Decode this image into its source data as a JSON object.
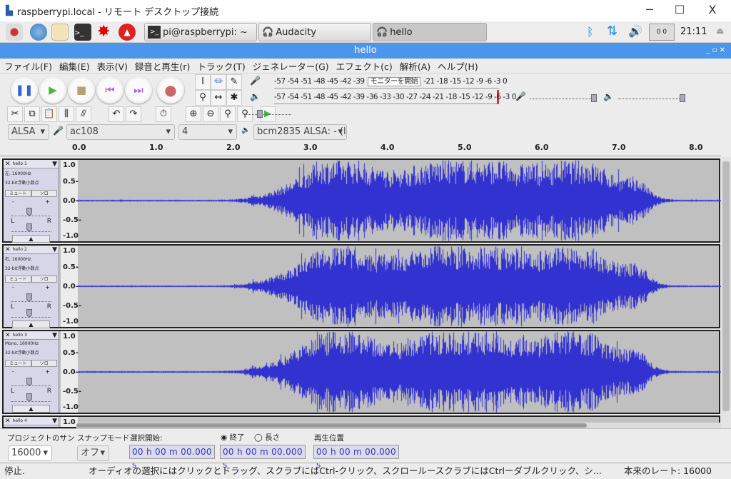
{
  "window": {
    "title": "raspberrypi.local - リモート デスクトップ接続",
    "min": "─",
    "max": "☐",
    "close": "X"
  },
  "taskbar": {
    "tasks": [
      {
        "label": "pi@raspberrypi: ~"
      },
      {
        "label": "Audacity"
      },
      {
        "label": "hello"
      }
    ],
    "clock": "21:11",
    "cpu": "0 0"
  },
  "app": {
    "title": "hello"
  },
  "menu": [
    "ファイル(F)",
    "編集(E)",
    "表示(V)",
    "録音と再生(r)",
    "トラック(T)",
    "ジェネレーター(G)",
    "エフェクト(c)",
    "解析(A)",
    "ヘルプ(H)"
  ],
  "meters": {
    "rec_scale": "-57 -54 -51 -48 -45 -42 -39",
    "rec_scale2": "-21 -18 -15 -12  -9  -6  -3  0",
    "monitor_label": "モニターを開始",
    "play_scale": "-57 -54 -51 -48 -45 -42 -39 -36 -33 -30 -27 -24 -21 -18 -15 -12  -9  -6  -3  0"
  },
  "devices": {
    "host": "ALSA",
    "input": "ac108",
    "channels": "4",
    "output": "bcm2835 ALSA: - (l"
  },
  "ruler": [
    "0.0",
    "1.0",
    "2.0",
    "3.0",
    "4.0",
    "5.0",
    "6.0",
    "7.0",
    "8.0"
  ],
  "tracks": [
    {
      "name": "hello 1",
      "info": "左, 16000Hz",
      "format": "32-bit浮動小数点"
    },
    {
      "name": "hello 2",
      "info": "右, 16000Hz",
      "format": "32-bit浮動小数点"
    },
    {
      "name": "hello 3",
      "info": "Mono, 16000Hz",
      "format": "32-bit浮動小数点"
    },
    {
      "name": "hello 4"
    }
  ],
  "track_ui": {
    "mute": "ミュート",
    "solo": "ソロ",
    "pan_l": "L",
    "pan_r": "R",
    "gain_minus": "-",
    "gain_plus": "+",
    "scale": [
      "1.0",
      "0.5-",
      "0.0-",
      "-0.5-",
      "-1.0"
    ]
  },
  "selection": {
    "rate_label": "プロジェクトのサン",
    "rate": "16000",
    "snap_label": "スナップモード",
    "snap": "オフ",
    "start_label": "選択開始:",
    "end_label": "終了",
    "length_label": "長さ",
    "end_selected": true,
    "pos_label": "再生位置",
    "start": "00 h 00 m 00.000 s",
    "end": "00 h 00 m 00.000 s",
    "pos": "00 h 00 m 00.000 s"
  },
  "status": {
    "state": "停止.",
    "hint": "オーディオの選択にはクリックとドラッグ、スクラブにはCtrl-クリック、スクロールースクラブにはCtrlーダブルクリック、シ...",
    "rate": "本来のレート: 16000"
  },
  "colors": {
    "wave": "#3232d0",
    "titlebar": "#4b96ea"
  }
}
